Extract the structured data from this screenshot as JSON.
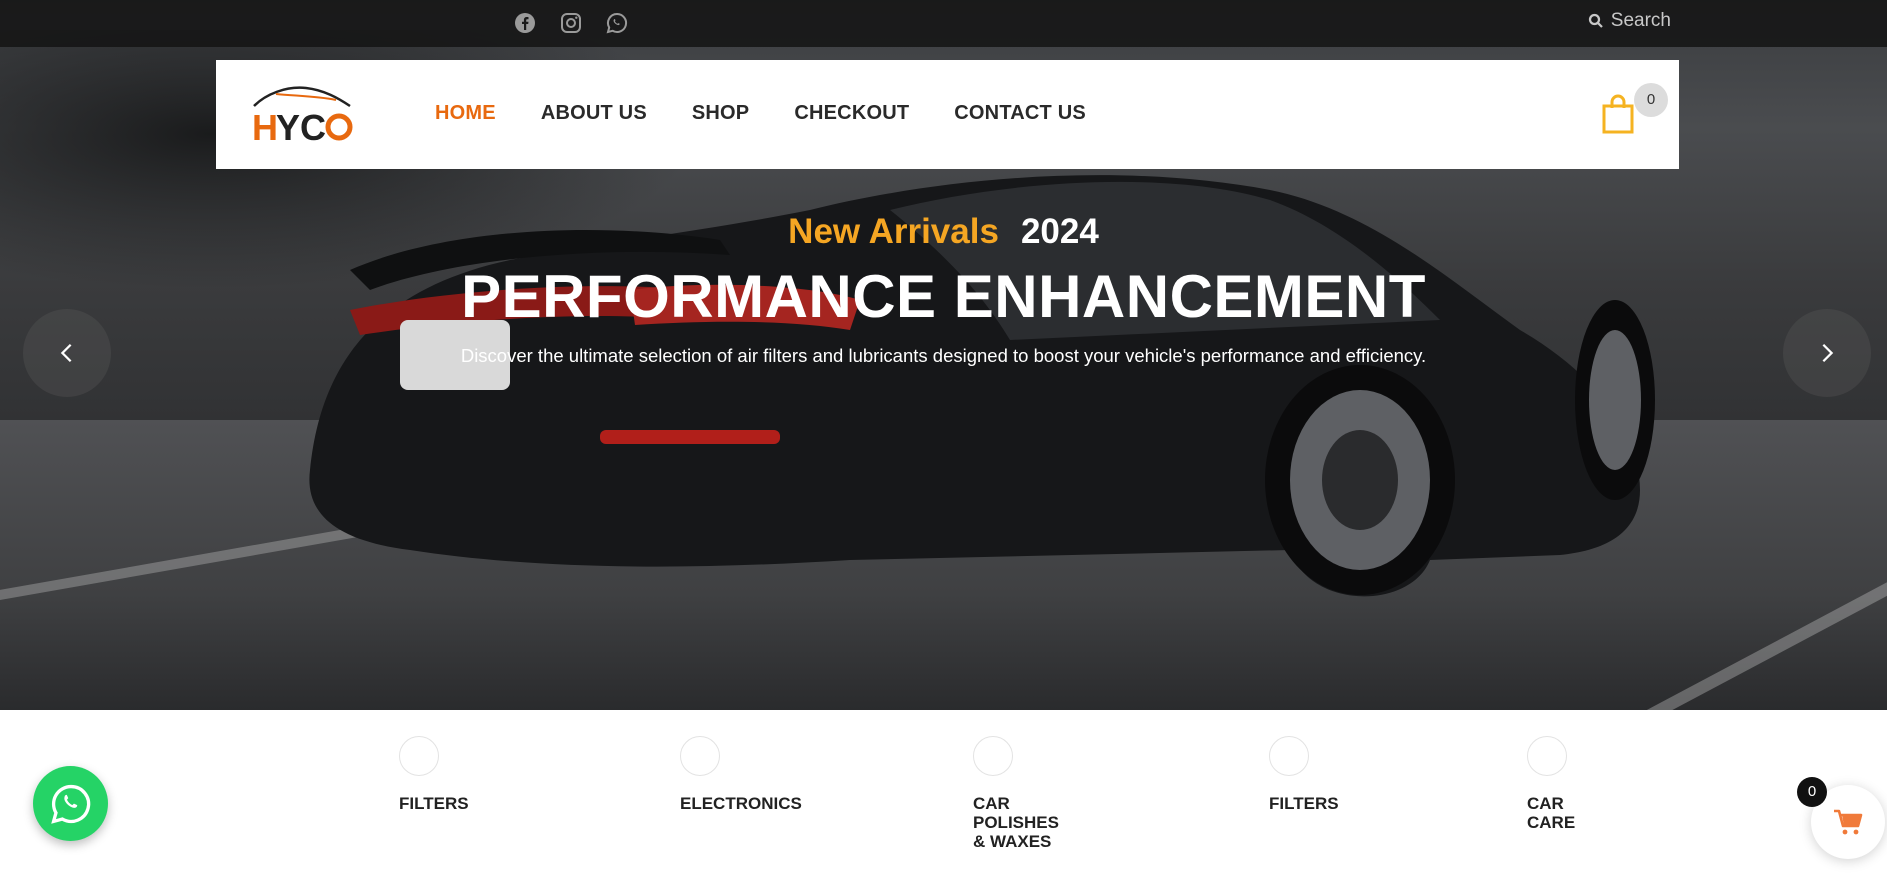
{
  "topbar": {
    "social_icons": [
      "facebook-icon",
      "instagram-icon",
      "whatsapp-icon"
    ],
    "search_label": "Search"
  },
  "header": {
    "logo_text": "HYCO",
    "nav": [
      "HOME",
      "ABOUT US",
      "SHOP",
      "CHECKOUT",
      "CONTACT US"
    ],
    "active_nav": "HOME",
    "cart_count": "0"
  },
  "hero": {
    "kicker_highlight": "New Arrivals",
    "kicker_year": "2024",
    "headline": "PERFORMANCE ENHANCEMENT",
    "subtitle": "Discover the ultimate selection of air filters and lubricants designed to boost your vehicle's performance and efficiency."
  },
  "categories": [
    {
      "label": "FILTERS"
    },
    {
      "label": "ELECTRONICS"
    },
    {
      "label": "CAR POLISHES & WAXES"
    },
    {
      "label": "FILTERS"
    },
    {
      "label": "CAR CARE"
    }
  ],
  "floating_cart": {
    "count": "0"
  },
  "colors": {
    "accent": "#e8690f",
    "kicker": "#f5a623",
    "whatsapp": "#25d366",
    "cart_icon": "#f5b321"
  }
}
